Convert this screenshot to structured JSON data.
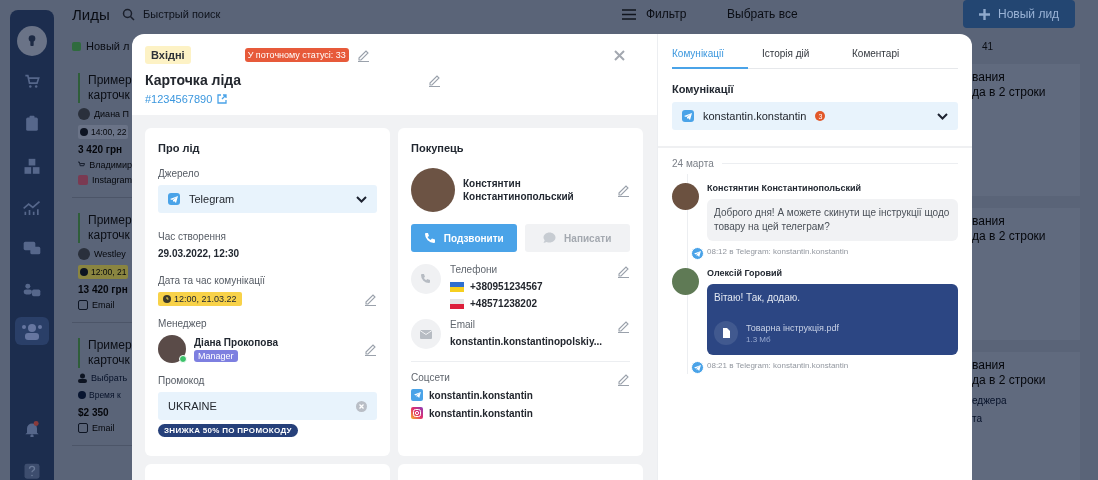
{
  "app": {
    "title": "Лиды",
    "search": {
      "placeholder": "Быстрый поиск"
    },
    "filter": "Фильтр",
    "select_all": "Выбрать все",
    "new_button": "Новый лид",
    "left_column": {
      "header": "Новый л",
      "cards": [
        {
          "title": [
            "Пример",
            "карточк"
          ],
          "person": {
            "kind": "avatar",
            "text": "Диана П"
          },
          "time": {
            "kind": "plain",
            "text": "14:00, 22"
          },
          "amount": "3 420 грн",
          "buyer": "Владимир",
          "channel": {
            "kind": "instagram",
            "text": "Instagram"
          }
        },
        {
          "title": [
            "Пример",
            "карточк"
          ],
          "person": {
            "kind": "avatar",
            "text": "Westley"
          },
          "time": {
            "kind": "warning",
            "text": "12:00, 21"
          },
          "amount": "13 420 грн",
          "channel": {
            "kind": "email",
            "text": "Email"
          }
        },
        {
          "title": [
            "Пример",
            "карточк"
          ],
          "person": {
            "kind": "link",
            "text": "Выбрать"
          },
          "time": {
            "kind": "link",
            "text": "Время к"
          },
          "amount": "$2 350",
          "channel": {
            "kind": "email",
            "text": "Email"
          }
        }
      ]
    },
    "right_column": {
      "count": "41",
      "cards": [
        {
          "title": [
            "вания",
            "да в 2 строки"
          ]
        },
        {
          "title": [
            "вания",
            "да в 2 строки"
          ]
        },
        {
          "title": [
            "вания",
            "да в 2 строки"
          ],
          "links": [
            "еджера",
            "та"
          ]
        }
      ]
    }
  },
  "modal": {
    "status": "Вхідні",
    "status_time": "У поточному статусі: 33",
    "title": "Карточка ліда",
    "id_link": "#1234567890",
    "lead": {
      "heading": "Про лід",
      "source": {
        "label": "Джерело",
        "value": "Telegram"
      },
      "created": {
        "label": "Час створення",
        "value": "29.03.2022, 12:30"
      },
      "contact_time": {
        "label": "Дата та час комунікації",
        "value": "12:00, 21.03.22"
      },
      "manager": {
        "label": "Менеджер",
        "name": "Діана Прокопова",
        "role": "Manager",
        "online": true
      },
      "promo": {
        "label": "Промокод",
        "value": "UKRAINE",
        "discount": "ЗНИЖКА 50% ПО ПРОМОКОДУ"
      }
    },
    "buyer": {
      "heading": "Покупець",
      "name": [
        "Констянтин",
        "Константинопольский"
      ],
      "buttons": [
        {
          "label": "Подзвонити",
          "kind": "call",
          "disabled": false
        },
        {
          "label": "Написати",
          "kind": "write",
          "disabled": true
        }
      ],
      "phones": {
        "label": "Телефони",
        "items": [
          {
            "kind": "ua",
            "number": "+380951234567"
          },
          {
            "kind": "pl",
            "number": "+48571238202"
          }
        ]
      },
      "email": {
        "label": "Email",
        "value": "konstantin.konstantinopolskiy..."
      },
      "socials": {
        "label": "Соцсети",
        "items": [
          {
            "kind": "telegram",
            "handle": "konstantin.konstantin"
          },
          {
            "kind": "instagram",
            "handle": "konstantin.konstantin"
          }
        ]
      }
    },
    "tabs": [
      {
        "label": "Комунікації",
        "selected": true
      },
      {
        "label": "Історія дій",
        "selected": false
      },
      {
        "label": "Коментарі",
        "selected": false
      }
    ],
    "communications": {
      "heading": "Комунікації",
      "channel": "konstantin.konstantin",
      "unread": "3",
      "date": "24 марта",
      "messages": [
        {
          "kind": "incoming",
          "author": "Констянтин Константинопольский",
          "text": "Доброго дня! А можете скинути ще інструкції щодо товару на цей телеграм?",
          "meta": "08:12 в Telegram: konstantin.konstantin"
        },
        {
          "kind": "outgoing",
          "author": "Олексій Горовий",
          "text": "Вітаю! Так, додаю.",
          "attachment": {
            "name": "Товарна інструкція.pdf",
            "size": "1.3 Мб"
          },
          "meta": "08:21 в Telegram: konstantin.konstantin"
        }
      ]
    }
  }
}
